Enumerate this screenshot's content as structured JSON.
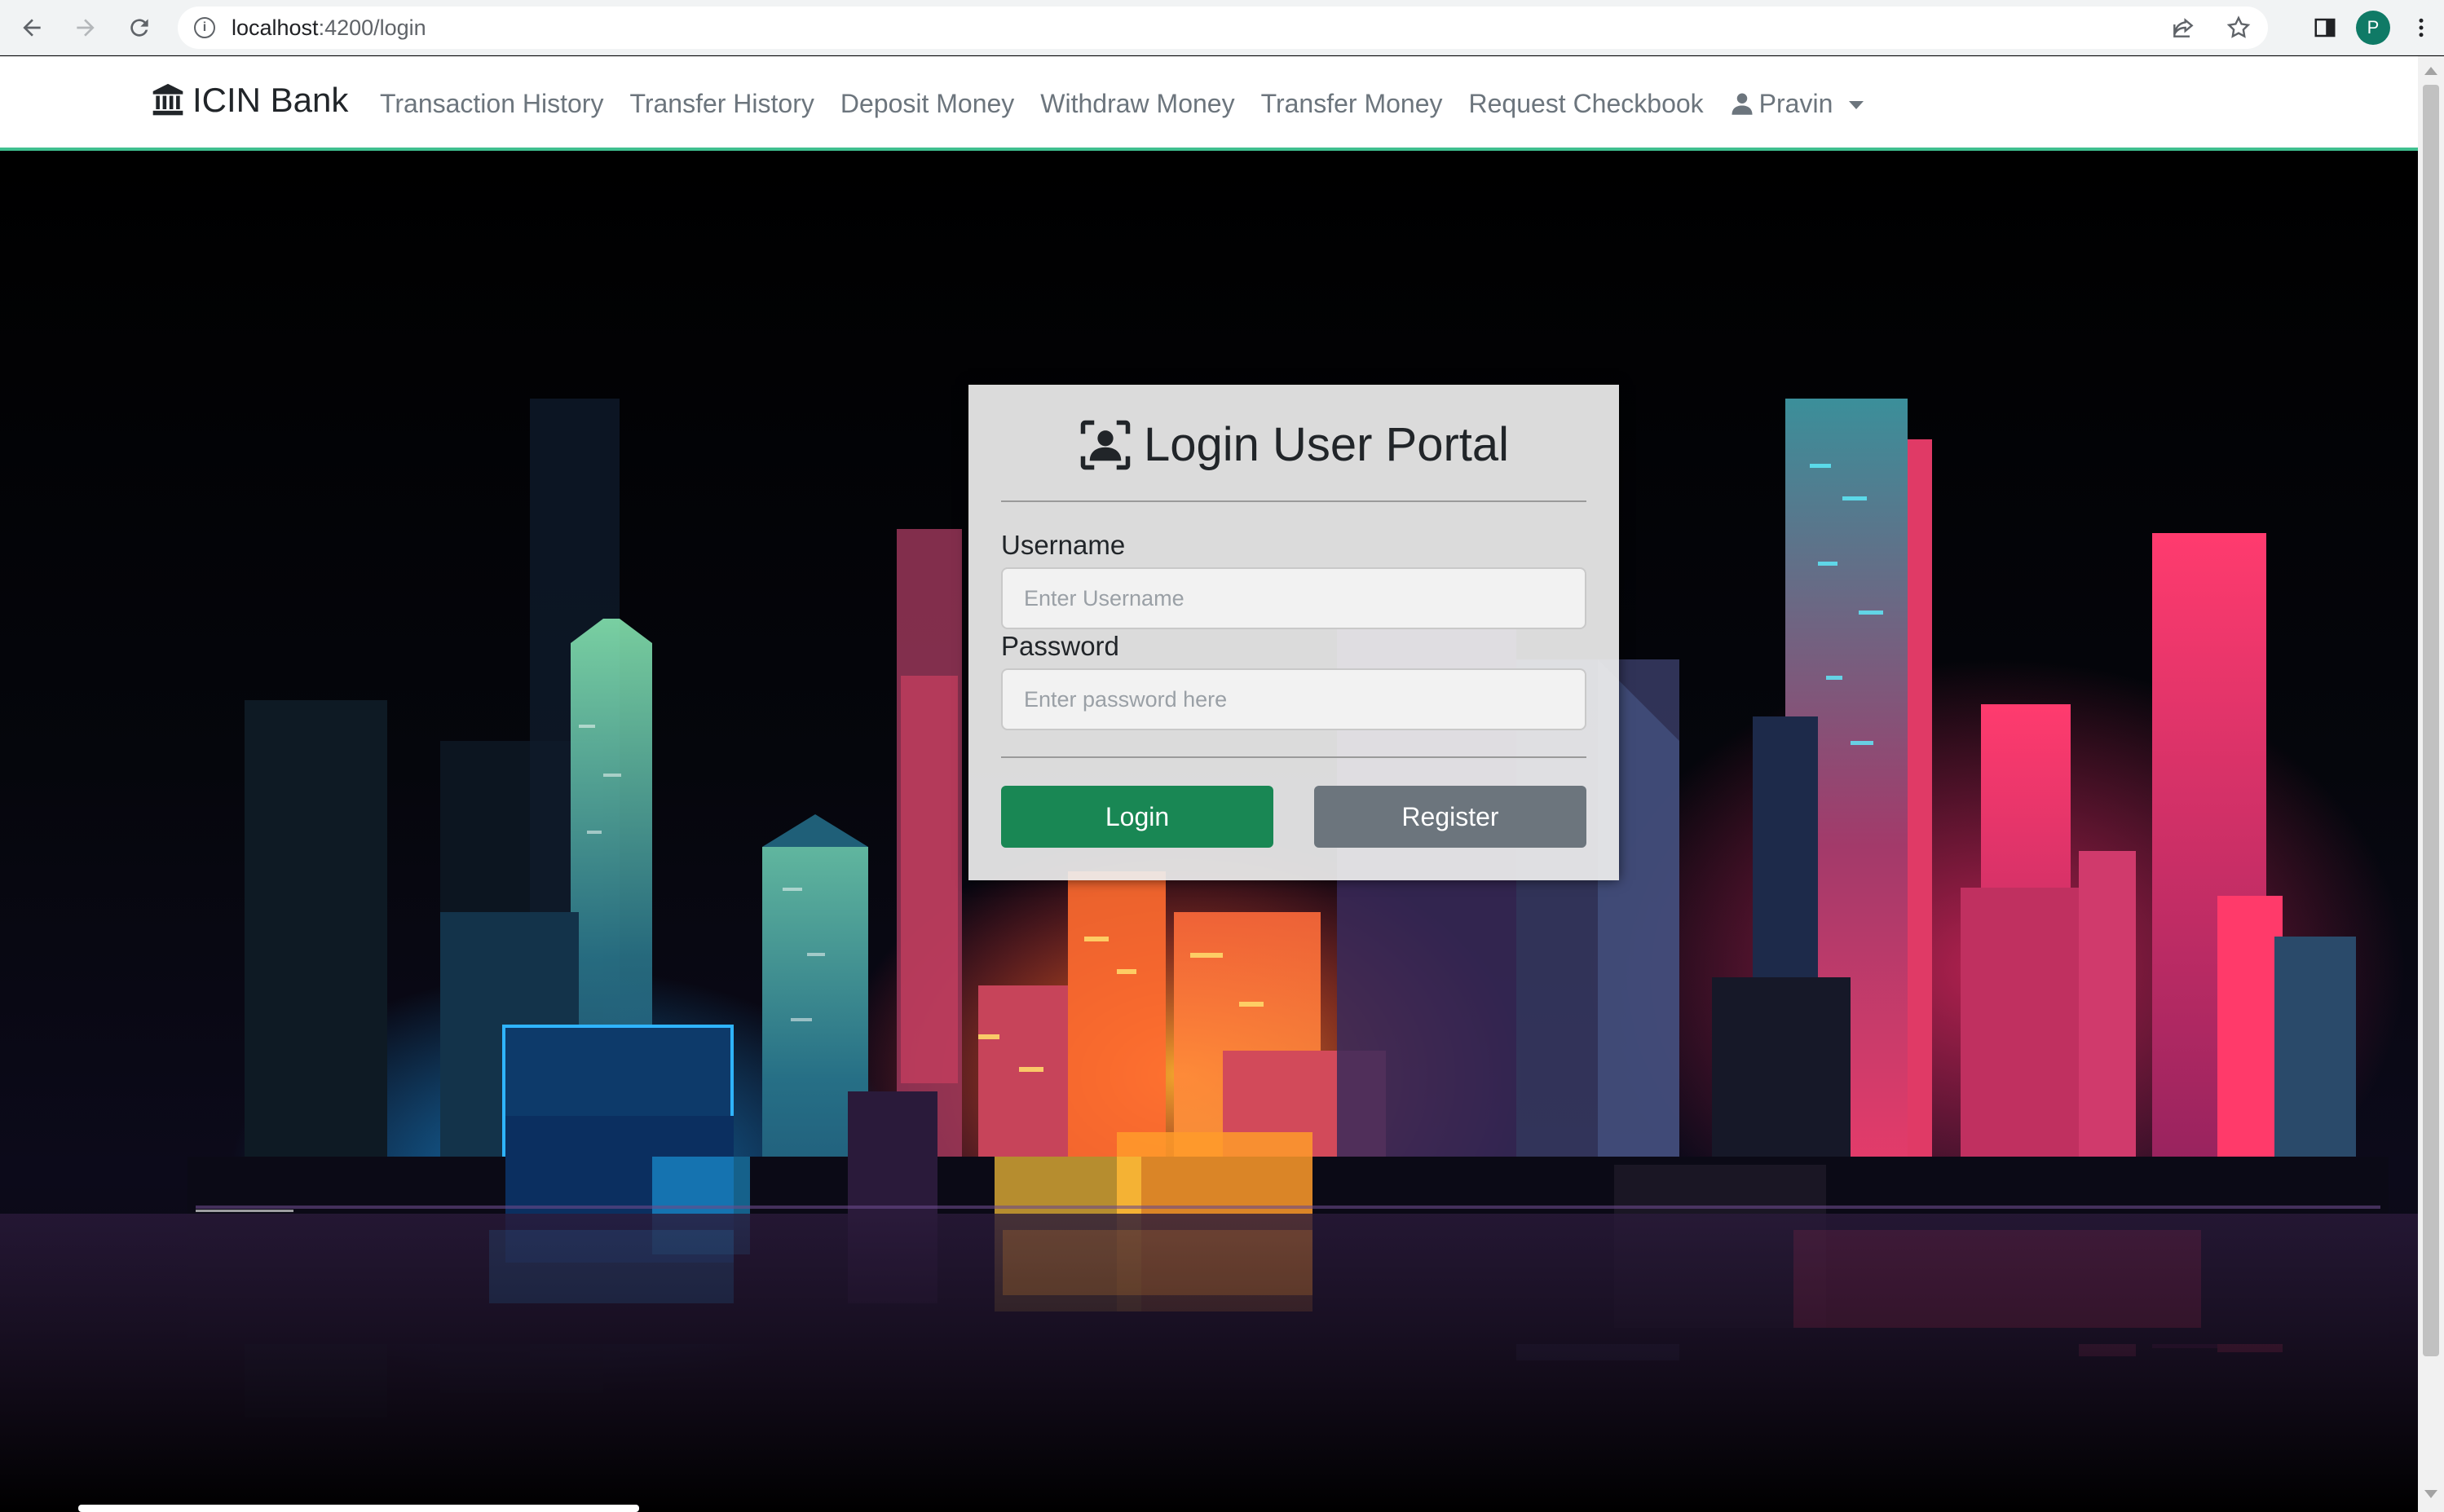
{
  "browser": {
    "url_host": "localhost",
    "url_path": ":4200/login",
    "profile_initial": "P"
  },
  "navbar": {
    "brand": "ICIN Bank",
    "links": [
      "Transaction History",
      "Transfer History",
      "Deposit Money",
      "Withdraw Money",
      "Transfer Money",
      "Request Checkbook"
    ],
    "user": "Pravin"
  },
  "login": {
    "title": "Login User Portal",
    "username_label": "Username",
    "username_placeholder": "Enter Username",
    "username_value": "",
    "password_label": "Password",
    "password_placeholder": "Enter password here",
    "password_value": "",
    "login_button": "Login",
    "register_button": "Register"
  },
  "colors": {
    "navbar_accent": "#3fbf8f",
    "login_button": "#198754",
    "register_button": "#6c757d",
    "profile_avatar": "#0f7a66"
  },
  "icons": {
    "brand": "bank-icon",
    "user": "user-icon",
    "title": "user-portrait-icon"
  }
}
